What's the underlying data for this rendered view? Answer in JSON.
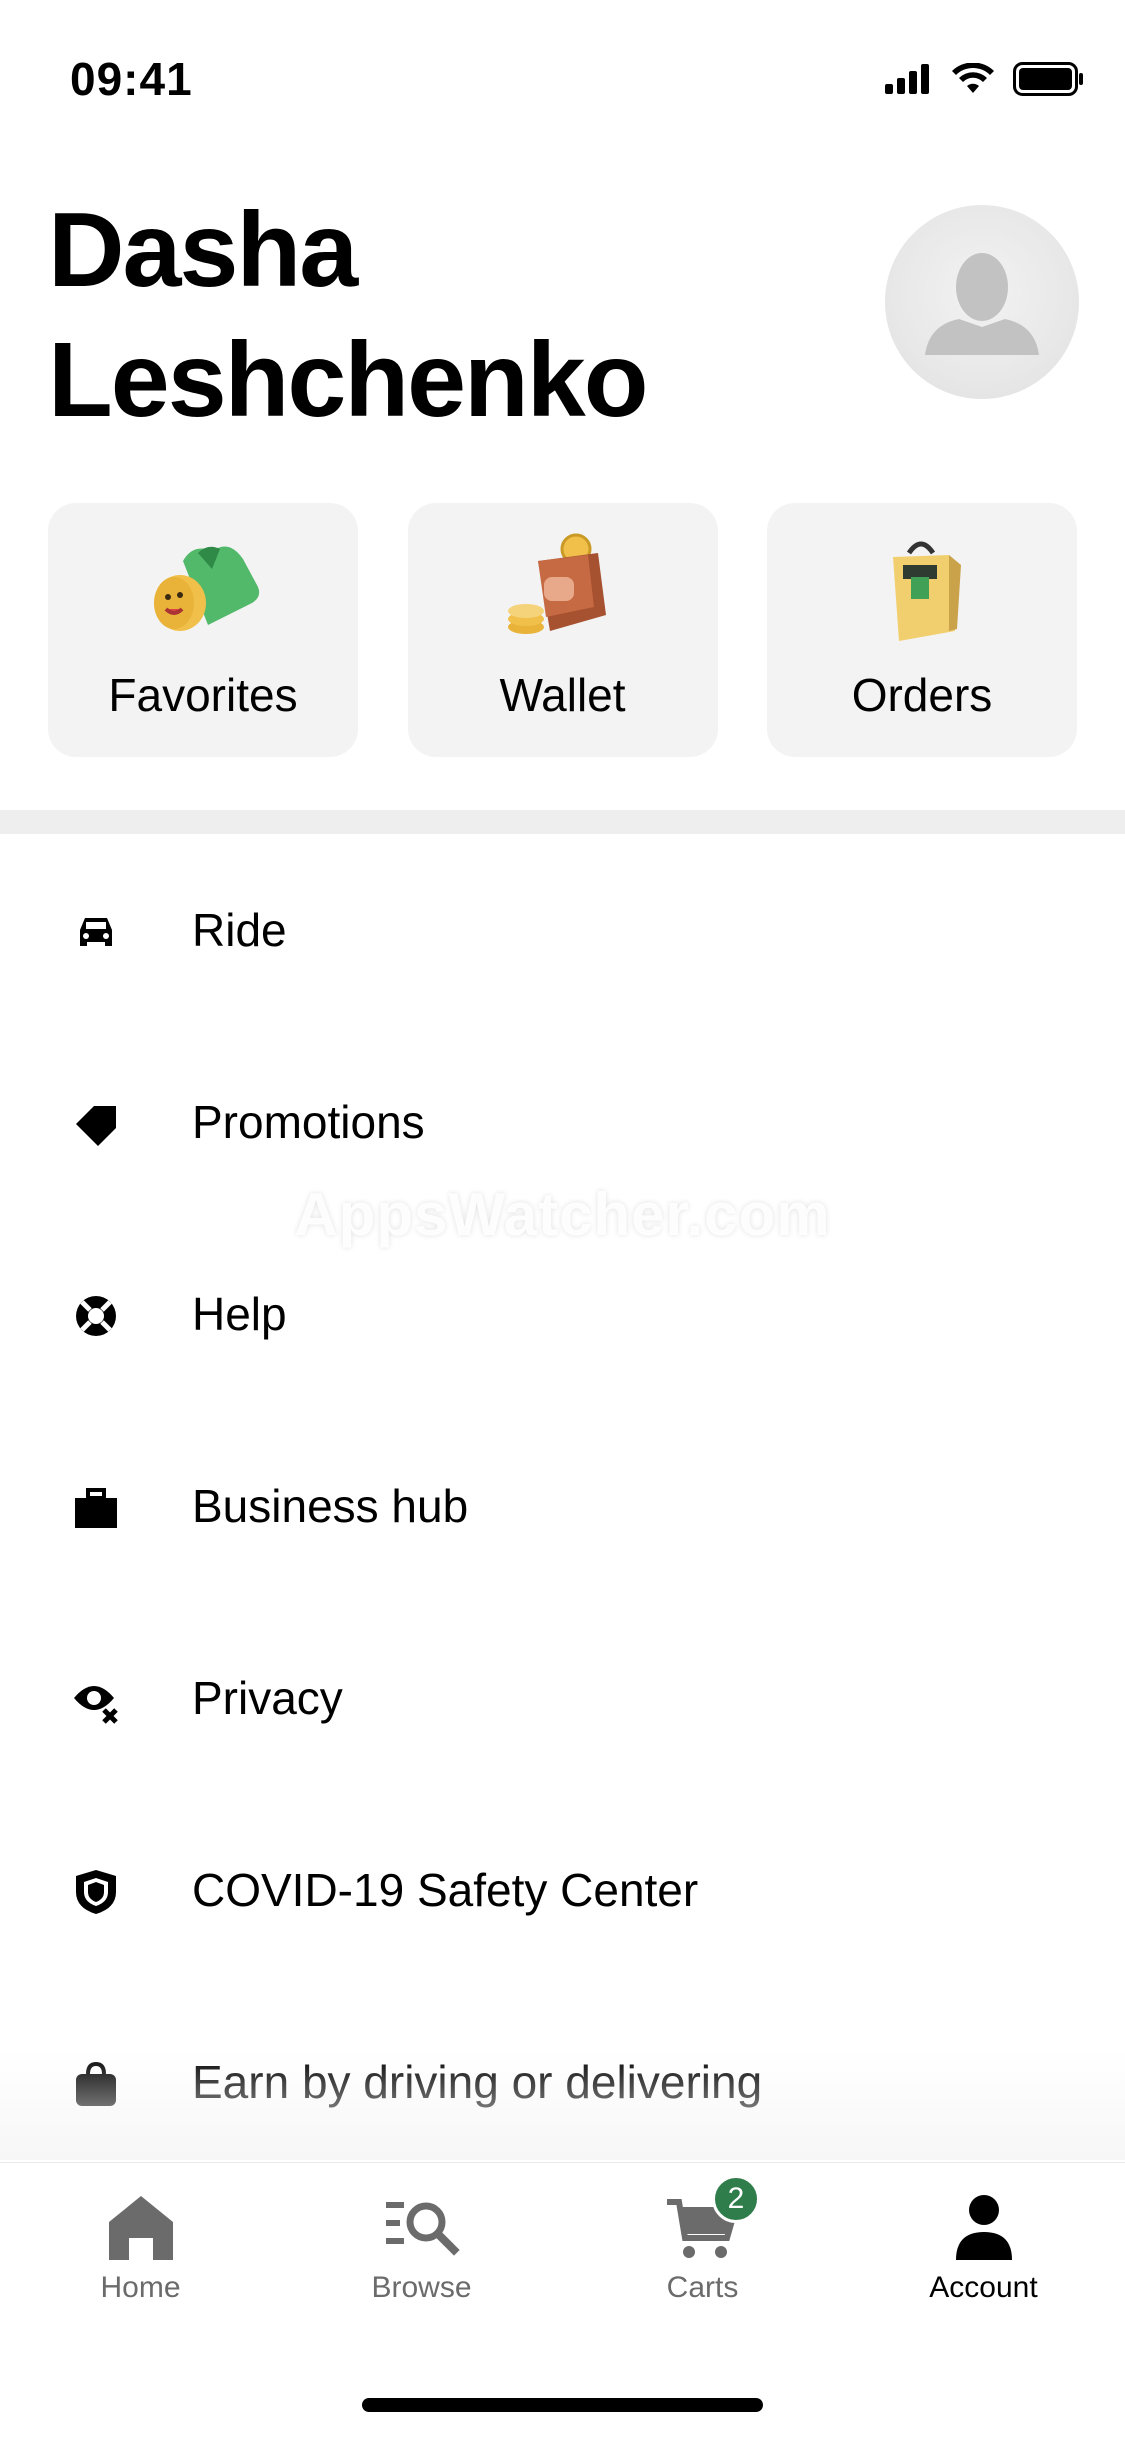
{
  "status": {
    "time": "09:41"
  },
  "profile": {
    "name": "Dasha Leshchenko"
  },
  "tiles": [
    {
      "label": "Favorites",
      "icon": "favorites-icon"
    },
    {
      "label": "Wallet",
      "icon": "wallet-icon"
    },
    {
      "label": "Orders",
      "icon": "orders-icon"
    }
  ],
  "menu": [
    {
      "label": "Ride",
      "icon": "car-icon"
    },
    {
      "label": "Promotions",
      "icon": "tag-icon"
    },
    {
      "label": "Help",
      "icon": "lifebuoy-icon"
    },
    {
      "label": "Business hub",
      "icon": "briefcase-icon"
    },
    {
      "label": "Privacy",
      "icon": "privacy-eye-icon"
    },
    {
      "label": "COVID-19 Safety Center",
      "icon": "shield-icon"
    },
    {
      "label": "Earn by driving or delivering",
      "icon": "bag-icon"
    }
  ],
  "tabbar": {
    "items": [
      {
        "label": "Home",
        "icon": "home-icon"
      },
      {
        "label": "Browse",
        "icon": "browse-icon"
      },
      {
        "label": "Carts",
        "icon": "cart-icon",
        "badge": "2"
      },
      {
        "label": "Account",
        "icon": "account-icon"
      }
    ],
    "active": "Account"
  },
  "watermark": "AppsWatcher.com",
  "colors": {
    "badge": "#2e7d4a",
    "tile_bg": "#f3f3f3",
    "inactive_tab": "#6b6b6b"
  }
}
